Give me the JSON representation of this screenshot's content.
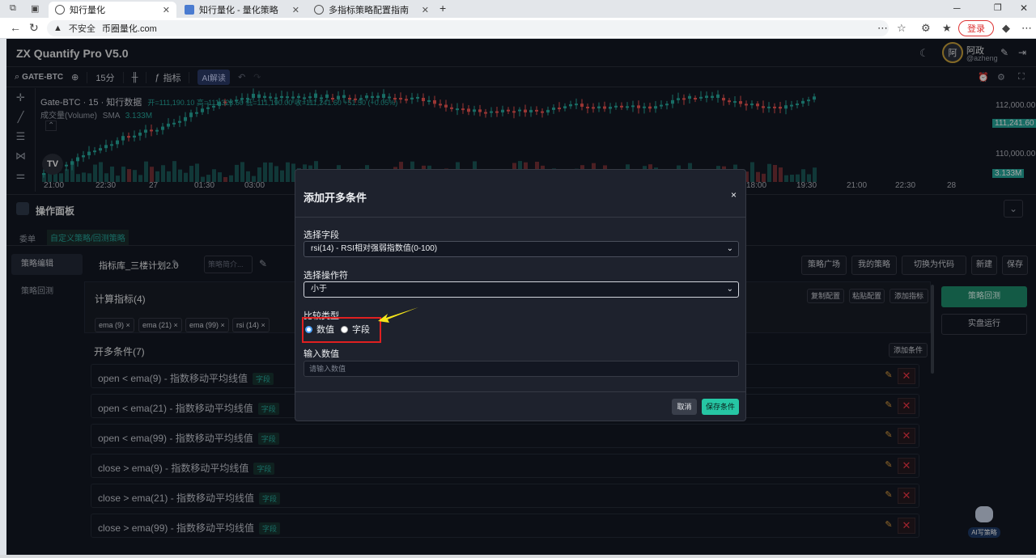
{
  "browser": {
    "tabs": [
      {
        "label": "知行量化"
      },
      {
        "label": "知行量化 - 量化策略"
      },
      {
        "label": "多指标策略配置指南"
      }
    ],
    "security": "不安全",
    "url": "币圈量化.com",
    "login": "登录"
  },
  "app": {
    "title": "ZX Quantify Pro V5.0",
    "user_initial": "阿",
    "user_name": "阿政",
    "user_handle": "@azheng"
  },
  "toolbar": {
    "symbol": "GATE-BTC",
    "interval": "15分",
    "indicators": "指标",
    "ai": "AI解读"
  },
  "chart": {
    "legend_title": "Gate-BTC · 15 · 知行数据",
    "ohlc": "开=111,190.10 高=111,323.50 低=111,190.00 收=111,241.60 +51.50 (+0.05%)",
    "volume_label": "成交量(Volume)",
    "volume_sma": "SMA",
    "volume_value": "3.133M",
    "price_ticks": [
      "112,000.00",
      "110,000.00"
    ],
    "last_price": "111,241.60",
    "volume_badge": "3.133M",
    "time_ticks": [
      "21:00",
      "22:30",
      "27",
      "01:30",
      "03:00",
      "18:00",
      "19:30",
      "21:00",
      "22:30",
      "28"
    ]
  },
  "panel": {
    "title": "操作面板",
    "subtabs": [
      "委单",
      "自定义策略/回测策略"
    ],
    "sidenav": [
      "策略编辑",
      "策略回测"
    ],
    "strategy_name": "指标库_三楼计划2.0",
    "strategy_desc_placeholder": "策略简介...",
    "actions": [
      "策略广场",
      "我的策略",
      "切换为代码",
      "新建",
      "保存"
    ],
    "indicators_title": "计算指标(4)",
    "indicator_actions": [
      "复制配置",
      "粘贴配置",
      "添加指标"
    ],
    "indicator_chips": [
      "ema (9)",
      "ema (21)",
      "ema (99)",
      "rsi (14)"
    ],
    "conditions_title": "开多条件(7)",
    "add_condition": "添加条件",
    "field_badge": "字段",
    "conditions": [
      "open  <  ema(9) - 指数移动平均线值",
      "open  <  ema(21) - 指数移动平均线值",
      "open  <  ema(99) - 指数移动平均线值",
      "close  >  ema(9) - 指数移动平均线值",
      "close  >  ema(21) - 指数移动平均线值",
      "close  >  ema(99) - 指数移动平均线值"
    ],
    "backtest": "策略回测",
    "live": "实盘运行",
    "ai_bot": "AI写策略"
  },
  "modal": {
    "title": "添加开多条件",
    "close": "×",
    "field_label": "选择字段",
    "field_value": "rsi(14) - RSI相对强弱指数值(0-100)",
    "operator_label": "选择操作符",
    "operator_value": "小于",
    "compare_label": "比较类型",
    "compare_options": [
      "数值",
      "字段"
    ],
    "compare_selected": "数值",
    "input_label": "输入数值",
    "input_placeholder": "请输入数值",
    "cancel": "取消",
    "save": "保存条件"
  },
  "colors": {
    "up": "#26a69a",
    "down": "#ef5350",
    "accent": "#26c6a4",
    "highlight": "#e02020",
    "arrow": "#f5e51a"
  }
}
